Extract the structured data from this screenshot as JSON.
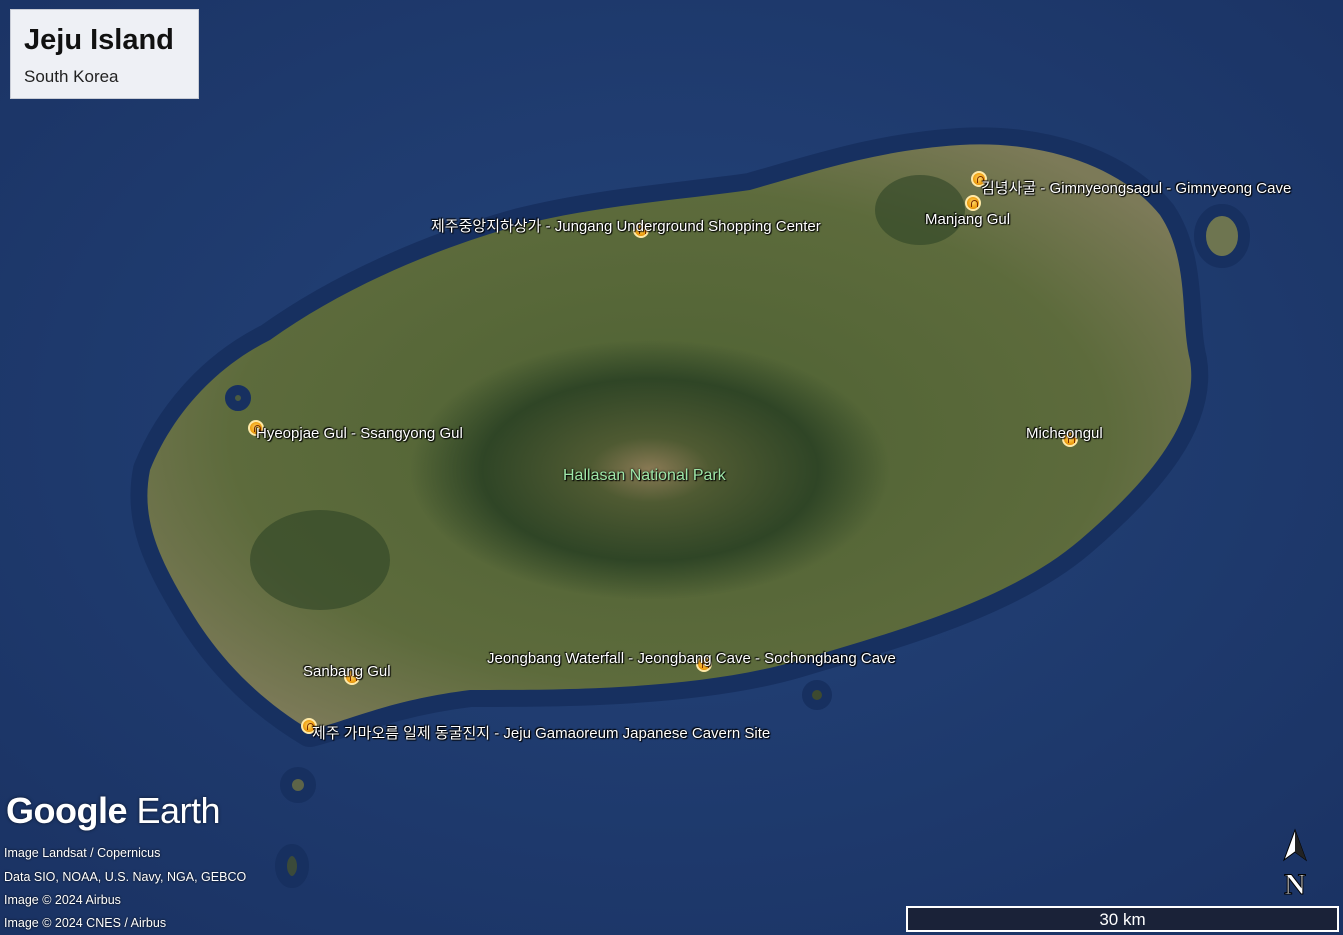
{
  "title": {
    "name": "Jeju Island",
    "subtitle": "South Korea"
  },
  "places": {
    "gimnyeong": "김녕사굴 - Gimnyeongsagul - Gimnyeong Cave",
    "manjang": "Manjang Gul",
    "jungang": "제주중앙지하상가 - Jungang Underground Shopping Center",
    "hyeopjae": "Hyeopjae Gul - Ssangyong Gul",
    "micheon": "Micheongul",
    "hallasan": "Hallasan National Park",
    "sanbang": "Sanbang Gul",
    "jeongbang": "Jeongbang Waterfall - Jeongbang Cave - Sochongbang Cave",
    "gamaoreum": "제주 가마오름 일제 동굴진지 - Jeju Gamaoreum Japanese Cavern Site"
  },
  "branding": {
    "logo_word1": "Google",
    "logo_word2": " Earth"
  },
  "credits": [
    "Image Landsat / Copernicus",
    "Data SIO, NOAA, U.S. Navy, NGA, GEBCO",
    "Image © 2024 Airbus",
    "Image © 2024 CNES / Airbus"
  ],
  "north_label": "N",
  "scale_label": "30 km",
  "colors": {
    "ocean": "#1f3a6e",
    "land": "#5b6a3a",
    "forest": "#2e4a22",
    "pin": "#f0a010"
  }
}
